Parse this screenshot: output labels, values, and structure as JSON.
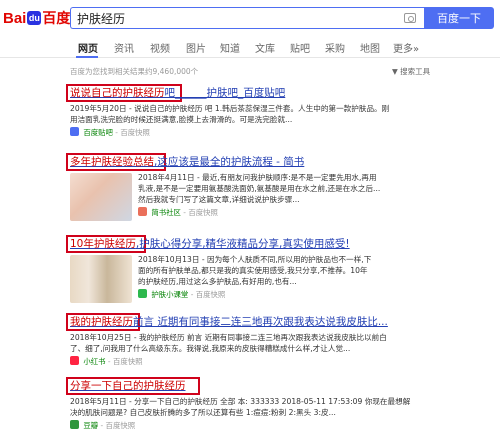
{
  "logo": {
    "bai": "Bai",
    "paw": "du",
    "du": "百度"
  },
  "search": {
    "query": "护肤经历",
    "button": "百度一下"
  },
  "tabs": [
    "网页",
    "资讯",
    "视频",
    "图片",
    "知道",
    "文库",
    "贴吧",
    "采购",
    "地图",
    "更多»"
  ],
  "count_text": "百度为您找到相关结果约9,460,000个",
  "tools_label": "搜索工具",
  "results": [
    {
      "title_a": "说说自己的护肤经历",
      "title_b": "吧______护肤吧_百度贴吧",
      "desc_line1": "2019年5月20日 - 说说自己的护肤经历 吧 1.韩后茶蕊保湿三件套。人生中的第一款护肤品。刚",
      "desc_line2": "用洁面乳洗完脸的时候还挺满意,脸摸上去滑滑的。可是洗完脸就...",
      "source": "百度贴吧",
      "snapshot": "百度快照"
    },
    {
      "title_a": "多年护肤经验总结",
      "title_b": ",这应该是最全的护肤流程 - 简书",
      "desc_line1": "2018年4月11日 - 最近,有朋友问我护肤顺序:是不是一定要先用水,再用",
      "desc_line2": "乳液,是不是一定要用氨基酸洗面奶,氨基酸是用在水之前,还是在水之后...",
      "desc_line3": "然后我就专门写了这篇文章,详细说说护肤步骤...",
      "source": "简书社区",
      "snapshot": "百度快照"
    },
    {
      "title_a": "10年护肤经历",
      "title_b": ",护肤心得分享,精华液精品分享,真实使用感受!",
      "desc_line1": "2018年10月13日 - 因为每个人肤质不同,所以用的护肤品也不一样,下",
      "desc_line2": "面的所有护肤单品,都只是我的真实使用感受,我只分享,不推荐。10年",
      "desc_line3": "的护肤经历,用过这么多护肤品,有好用的,也有...",
      "source": "护肤小课堂",
      "snapshot": "百度快照"
    },
    {
      "title_a": "我的护肤经历",
      "title_b": "前言 近期有同事接二连三地再次跟我表达说我皮肤比...",
      "desc_line1": "2018年10月25日 - 我的护肤经历 前言 近期有同事接二连三地再次跟我表达说我皮肤比以前白",
      "desc_line2": "了、细了,问我用了什么高级东东。我得说,我原来的皮肤得糟糕成什么样,才让人觉...",
      "source": "小红书",
      "snapshot": "百度快照"
    },
    {
      "title_a": "分享一下自己的护肤经历",
      "title_b": "",
      "desc_line1": "2018年5月11日 - 分享一下自己的护肤经历 全部 本: 333333 2018-05-11 17:53:09 你现在最想解",
      "desc_line2": "决的肌肤问题是? 自己皮肤折腾的多了所以还算有些 1:痘痘:粉刺 2:黑头 3:皮...",
      "source": "豆瓣",
      "snapshot": "百度快照"
    }
  ],
  "colors": {
    "link": "#2440b3",
    "highlight_box": "#d0021b",
    "brand": "#4e6ef2"
  }
}
